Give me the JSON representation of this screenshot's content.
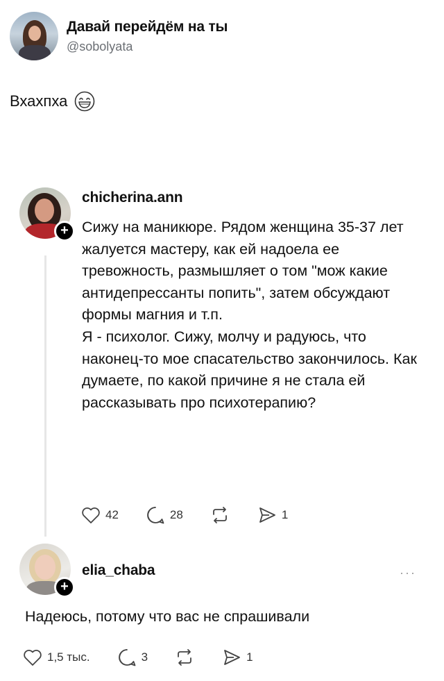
{
  "tweet": {
    "display_name": "Давай перейдём на ты",
    "handle": "@sobolyata",
    "text": "Вхахпха",
    "emoji": "grinning-face-emoji"
  },
  "thread_post": {
    "username": "chicherina.ann",
    "paragraphs": [
      "Сижу на маникюре. Рядом женщина 35-37 лет жалуется мастеру, как ей надоела ее тревожность, размышляет о том \"мож какие антидепрессанты попить\", затем обсуждают формы магния и т.п.",
      "Я - психолог. Сижу, молчу и радуюсь, что наконец-то мое спасательство закончилось. Как думаете, по какой причине я не стала ей рассказывать про психотерапию?"
    ],
    "actions": {
      "likes": "42",
      "comments": "28",
      "shares": "1"
    }
  },
  "reply": {
    "username": "elia_chaba",
    "more": "···",
    "text": "Надеюсь, потому что вас не спрашивали",
    "actions": {
      "likes": "1,5 тыс.",
      "comments": "3",
      "shares": "1"
    }
  },
  "colors": {
    "text": "#111111",
    "muted": "#6b6f74",
    "icon": "#444444",
    "thread_line": "#e6e6e6"
  }
}
